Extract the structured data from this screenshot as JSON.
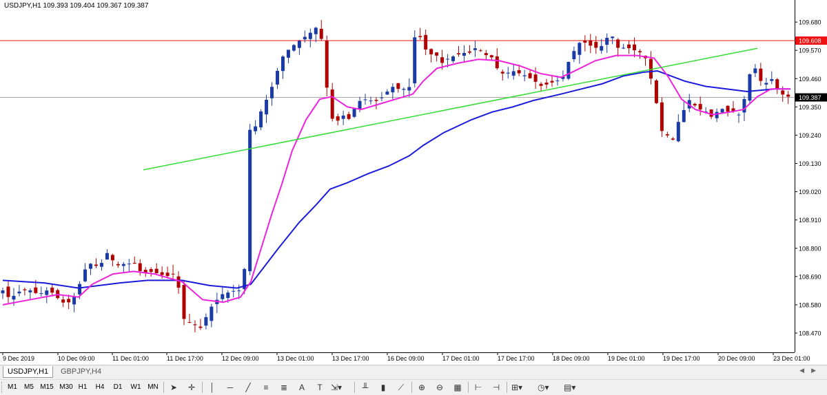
{
  "symbol_info": "USDJPY,H1  109.393 109.404 109.367 109.387",
  "colors": {
    "bull": "#1a3aa6",
    "bear": "#b00000",
    "ma_slow": "#1a1adb",
    "ma_fast": "#ee22dd",
    "trendline": "#33dd33",
    "resistance": "#ee1111",
    "current_line": "#aaaaaa"
  },
  "chart_data": {
    "type": "candlestick",
    "instrument": "USDJPY",
    "timeframe": "H1",
    "ylim": [
      108.395,
      109.766
    ],
    "y_ticks": [
      "109.680",
      "109.570",
      "109.460",
      "109.350",
      "109.240",
      "109.130",
      "109.020",
      "108.910",
      "108.800",
      "108.690",
      "108.580",
      "108.470"
    ],
    "x_ticks": [
      "9 Dec 2019",
      "10 Dec 09:00",
      "11 Dec 01:00",
      "11 Dec 17:00",
      "12 Dec 09:00",
      "13 Dec 01:00",
      "13 Dec 17:00",
      "16 Dec 09:00",
      "17 Dec 01:00",
      "17 Dec 17:00",
      "18 Dec 09:00",
      "19 Dec 01:00",
      "19 Dec 17:00",
      "20 Dec 09:00",
      "23 Dec 01:00"
    ],
    "resistance_level": "109.608",
    "current_price": "109.387",
    "trendline": {
      "from": [
        "9 Dec 2019 ~21:00",
        109.105
      ],
      "to": [
        "23 Dec ~04:00",
        109.578
      ]
    },
    "price_path": [
      [
        0,
        108.62
      ],
      [
        10,
        108.64
      ],
      [
        18,
        108.6
      ],
      [
        30,
        108.63
      ],
      [
        45,
        108.64
      ],
      [
        60,
        108.62
      ],
      [
        75,
        108.64
      ],
      [
        90,
        108.6
      ],
      [
        100,
        108.58
      ],
      [
        115,
        108.62
      ],
      [
        125,
        108.71
      ],
      [
        135,
        108.74
      ],
      [
        145,
        108.73
      ],
      [
        155,
        108.75
      ],
      [
        162,
        108.8
      ],
      [
        170,
        108.73
      ],
      [
        185,
        108.74
      ],
      [
        200,
        108.74
      ],
      [
        210,
        108.7
      ],
      [
        220,
        108.71
      ],
      [
        235,
        108.7
      ],
      [
        245,
        108.69
      ],
      [
        255,
        108.7
      ],
      [
        262,
        108.67
      ],
      [
        268,
        108.53
      ],
      [
        280,
        108.51
      ],
      [
        295,
        108.49
      ],
      [
        310,
        108.57
      ],
      [
        325,
        108.62
      ],
      [
        338,
        108.63
      ],
      [
        350,
        108.64
      ],
      [
        356,
        108.6
      ],
      [
        360,
        108.78
      ],
      [
        366,
        109.26
      ],
      [
        374,
        109.27
      ],
      [
        385,
        109.35
      ],
      [
        395,
        109.4
      ],
      [
        405,
        109.48
      ],
      [
        415,
        109.55
      ],
      [
        425,
        109.58
      ],
      [
        435,
        109.6
      ],
      [
        445,
        109.62
      ],
      [
        455,
        109.64
      ],
      [
        463,
        109.66
      ],
      [
        470,
        109.62
      ],
      [
        476,
        109.48
      ],
      [
        482,
        109.33
      ],
      [
        490,
        109.28
      ],
      [
        500,
        109.32
      ],
      [
        512,
        109.3
      ],
      [
        522,
        109.37
      ],
      [
        535,
        109.38
      ],
      [
        548,
        109.37
      ],
      [
        560,
        109.39
      ],
      [
        572,
        109.43
      ],
      [
        582,
        109.42
      ],
      [
        592,
        109.42
      ],
      [
        600,
        109.43
      ],
      [
        606,
        109.63
      ],
      [
        615,
        109.62
      ],
      [
        625,
        109.55
      ],
      [
        635,
        109.56
      ],
      [
        645,
        109.52
      ],
      [
        655,
        109.54
      ],
      [
        665,
        109.55
      ],
      [
        675,
        109.56
      ],
      [
        685,
        109.56
      ],
      [
        692,
        109.58
      ],
      [
        700,
        109.57
      ],
      [
        710,
        109.55
      ],
      [
        720,
        109.54
      ],
      [
        728,
        109.48
      ],
      [
        738,
        109.48
      ],
      [
        748,
        109.49
      ],
      [
        758,
        109.48
      ],
      [
        768,
        109.47
      ],
      [
        780,
        109.45
      ],
      [
        790,
        109.43
      ],
      [
        800,
        109.44
      ],
      [
        810,
        109.45
      ],
      [
        820,
        109.46
      ],
      [
        828,
        109.52
      ],
      [
        835,
        109.56
      ],
      [
        845,
        109.6
      ],
      [
        855,
        109.6
      ],
      [
        865,
        109.58
      ],
      [
        875,
        109.58
      ],
      [
        885,
        109.62
      ],
      [
        890,
        109.65
      ],
      [
        897,
        109.58
      ],
      [
        905,
        109.58
      ],
      [
        915,
        109.58
      ],
      [
        925,
        109.57
      ],
      [
        935,
        109.56
      ],
      [
        943,
        109.53
      ],
      [
        950,
        109.44
      ],
      [
        955,
        109.39
      ],
      [
        960,
        109.3
      ],
      [
        965,
        109.25
      ],
      [
        972,
        109.24
      ],
      [
        980,
        109.22
      ],
      [
        988,
        109.29
      ],
      [
        995,
        109.33
      ],
      [
        1003,
        109.38
      ],
      [
        1010,
        109.36
      ],
      [
        1020,
        109.34
      ],
      [
        1030,
        109.33
      ],
      [
        1040,
        109.3
      ],
      [
        1048,
        109.36
      ],
      [
        1057,
        109.32
      ],
      [
        1065,
        109.35
      ],
      [
        1072,
        109.31
      ],
      [
        1080,
        109.33
      ],
      [
        1087,
        109.42
      ],
      [
        1093,
        109.49
      ],
      [
        1100,
        109.5
      ],
      [
        1108,
        109.45
      ],
      [
        1115,
        109.44
      ],
      [
        1122,
        109.47
      ],
      [
        1128,
        109.43
      ],
      [
        1135,
        109.41
      ],
      [
        1143,
        109.39
      ]
    ],
    "ma_slow_path": [
      [
        0,
        108.675
      ],
      [
        60,
        108.665
      ],
      [
        110,
        108.645
      ],
      [
        170,
        108.665
      ],
      [
        210,
        108.675
      ],
      [
        260,
        108.675
      ],
      [
        300,
        108.655
      ],
      [
        340,
        108.645
      ],
      [
        360,
        108.66
      ],
      [
        380,
        108.73
      ],
      [
        400,
        108.8
      ],
      [
        430,
        108.9
      ],
      [
        455,
        108.97
      ],
      [
        475,
        109.03
      ],
      [
        500,
        109.055
      ],
      [
        530,
        109.09
      ],
      [
        560,
        109.12
      ],
      [
        590,
        109.16
      ],
      [
        610,
        109.2
      ],
      [
        640,
        109.25
      ],
      [
        680,
        109.3
      ],
      [
        710,
        109.33
      ],
      [
        740,
        109.35
      ],
      [
        770,
        109.375
      ],
      [
        810,
        109.4
      ],
      [
        840,
        109.42
      ],
      [
        870,
        109.44
      ],
      [
        900,
        109.47
      ],
      [
        930,
        109.485
      ],
      [
        950,
        109.49
      ],
      [
        970,
        109.47
      ],
      [
        990,
        109.45
      ],
      [
        1020,
        109.43
      ],
      [
        1050,
        109.42
      ],
      [
        1080,
        109.41
      ],
      [
        1100,
        109.415
      ],
      [
        1120,
        109.42
      ],
      [
        1143,
        109.42
      ]
    ],
    "ma_fast_path": [
      [
        0,
        108.58
      ],
      [
        40,
        108.6
      ],
      [
        80,
        108.62
      ],
      [
        110,
        108.61
      ],
      [
        130,
        108.66
      ],
      [
        160,
        108.7
      ],
      [
        190,
        108.71
      ],
      [
        220,
        108.7
      ],
      [
        260,
        108.67
      ],
      [
        290,
        108.6
      ],
      [
        320,
        108.59
      ],
      [
        345,
        108.61
      ],
      [
        360,
        108.67
      ],
      [
        375,
        108.8
      ],
      [
        390,
        108.93
      ],
      [
        405,
        109.05
      ],
      [
        420,
        109.18
      ],
      [
        440,
        109.3
      ],
      [
        460,
        109.38
      ],
      [
        478,
        109.39
      ],
      [
        500,
        109.35
      ],
      [
        520,
        109.34
      ],
      [
        545,
        109.36
      ],
      [
        570,
        109.38
      ],
      [
        595,
        109.4
      ],
      [
        610,
        109.45
      ],
      [
        630,
        109.5
      ],
      [
        660,
        109.52
      ],
      [
        690,
        109.535
      ],
      [
        720,
        109.53
      ],
      [
        750,
        109.51
      ],
      [
        780,
        109.48
      ],
      [
        810,
        109.465
      ],
      [
        830,
        109.49
      ],
      [
        860,
        109.53
      ],
      [
        890,
        109.55
      ],
      [
        920,
        109.55
      ],
      [
        945,
        109.54
      ],
      [
        965,
        109.47
      ],
      [
        985,
        109.38
      ],
      [
        1005,
        109.34
      ],
      [
        1030,
        109.32
      ],
      [
        1055,
        109.33
      ],
      [
        1075,
        109.34
      ],
      [
        1095,
        109.39
      ],
      [
        1115,
        109.42
      ],
      [
        1143,
        109.42
      ]
    ]
  },
  "tabs": [
    {
      "label": "USDJPY,H1",
      "active": true
    },
    {
      "label": "GBPJPY,H4",
      "active": false
    }
  ],
  "timeframes": [
    "M1",
    "M5",
    "M15",
    "M30",
    "H1",
    "H4",
    "D1",
    "W1",
    "MN"
  ]
}
